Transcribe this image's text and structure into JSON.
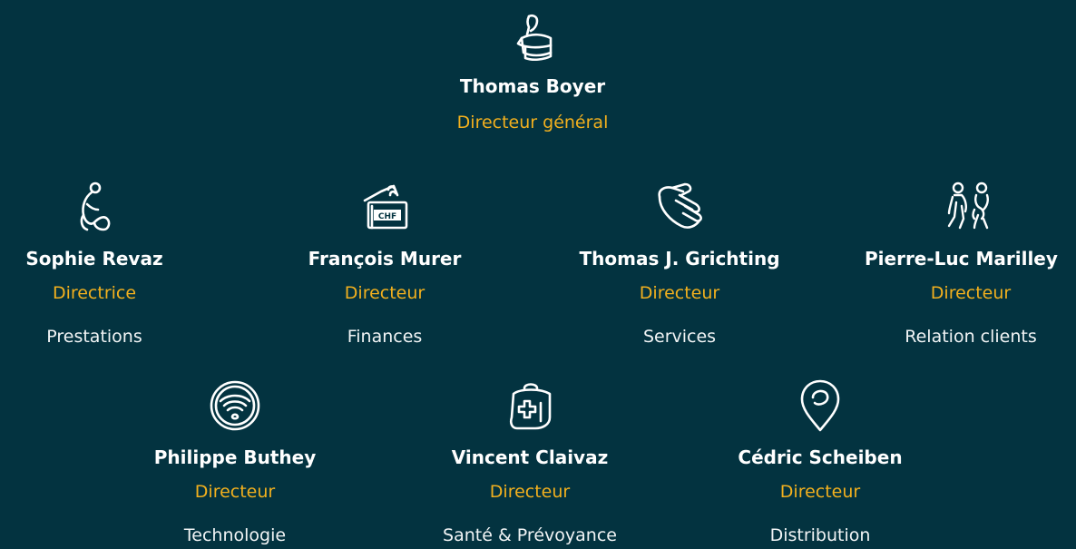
{
  "colors": {
    "background": "#033340",
    "accent": "#f2b01e",
    "text": "#ffffff"
  },
  "people": {
    "boyer": {
      "name": "Thomas Boyer",
      "role": "Directeur général",
      "icon": "person-box-icon"
    },
    "revaz": {
      "name": "Sophie Revaz",
      "role": "Directrice",
      "department": "Prestations",
      "icon": "family-care-icon"
    },
    "murer": {
      "name": "François Murer",
      "role": "Directeur",
      "department": "Finances",
      "icon": "chf-wallet-icon",
      "icon_text": "CHF"
    },
    "grichting": {
      "name": "Thomas J. Grichting",
      "role": "Directeur",
      "department": "Services",
      "icon": "open-hand-icon"
    },
    "marilley": {
      "name": "Pierre-Luc Marilley",
      "role": "Directeur",
      "department": "Relation clients",
      "icon": "two-people-icon"
    },
    "buthey": {
      "name": "Philippe Buthey",
      "role": "Directeur",
      "department": "Technologie",
      "icon": "wifi-circle-icon"
    },
    "claivaz": {
      "name": "Vincent Claivaz",
      "role": "Directeur",
      "department": "Santé & Prévoyance",
      "icon": "medical-kit-icon"
    },
    "scheiben": {
      "name": "Cédric Scheiben",
      "role": "Directeur",
      "department": "Distribution",
      "icon": "location-pin-icon"
    }
  }
}
